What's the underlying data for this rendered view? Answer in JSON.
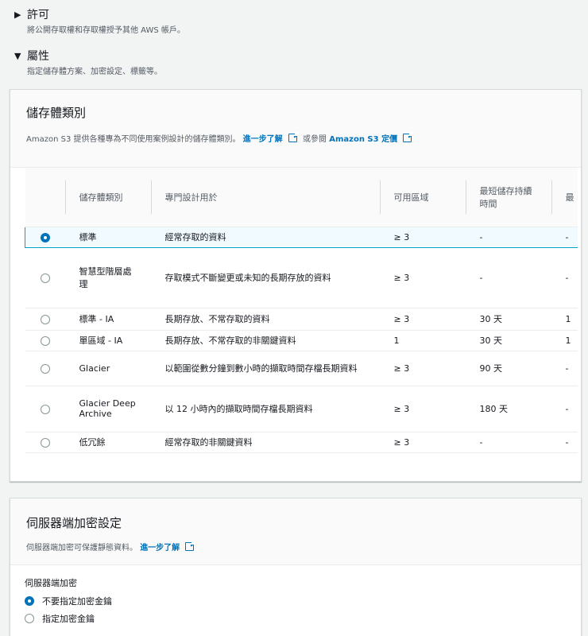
{
  "permissions": {
    "title": "許可",
    "desc": "將公開存取權和存取權授予其他 AWS 帳戶。"
  },
  "properties": {
    "title": "屬性",
    "desc": "指定儲存體方案、加密設定、標籤等。"
  },
  "storage_class": {
    "title": "儲存體類別",
    "desc_prefix": "Amazon S3 提供各種專為不同使用案例設計的儲存體類別。",
    "learn_more": "進一步了解",
    "or_see": "或參閱",
    "pricing_link": "Amazon S3 定價",
    "columns": [
      "儲存體類別",
      "專門設計用於",
      "可用區域",
      "最短儲存持續時間",
      "最"
    ],
    "rows": [
      {
        "name": "標準",
        "use": "經常存取的資料",
        "az": "≥ 3",
        "min": "-",
        "extra": "-",
        "selected": true
      },
      {
        "name": "智慧型階層處理",
        "use": "存取模式不斷變更或未知的長期存放的資料",
        "az": "≥ 3",
        "min": "-",
        "extra": "-",
        "selected": false
      },
      {
        "name": "標準 - IA",
        "use": "長期存放、不常存取的資料",
        "az": "≥ 3",
        "min": "30 天",
        "extra": "1",
        "selected": false
      },
      {
        "name": "單區域 - IA",
        "use": "長期存放、不常存取的非關鍵資料",
        "az": "1",
        "min": "30 天",
        "extra": "1",
        "selected": false
      },
      {
        "name": "Glacier",
        "use": "以範圍從數分鐘到數小時的擷取時間存檔長期資料",
        "az": "≥ 3",
        "min": "90 天",
        "extra": "-",
        "selected": false
      },
      {
        "name": "Glacier Deep Archive",
        "use": "以 12 小時內的擷取時間存檔長期資料",
        "az": "≥ 3",
        "min": "180 天",
        "extra": "-",
        "selected": false
      },
      {
        "name": "低冗餘",
        "use": "經常存取的非關鍵資料",
        "az": "≥ 3",
        "min": "-",
        "extra": "-",
        "selected": false
      }
    ]
  },
  "encryption": {
    "title": "伺服器端加密設定",
    "desc": "伺服器端加密可保護靜態資料。",
    "learn_more": "進一步了解",
    "field_label": "伺服器端加密",
    "options": [
      {
        "label": "不要指定加密金鑰",
        "checked": true
      },
      {
        "label": "指定加密金鑰",
        "checked": false
      }
    ]
  },
  "colors": {
    "link": "#0073bb",
    "selected_border": "#00a1c9"
  }
}
